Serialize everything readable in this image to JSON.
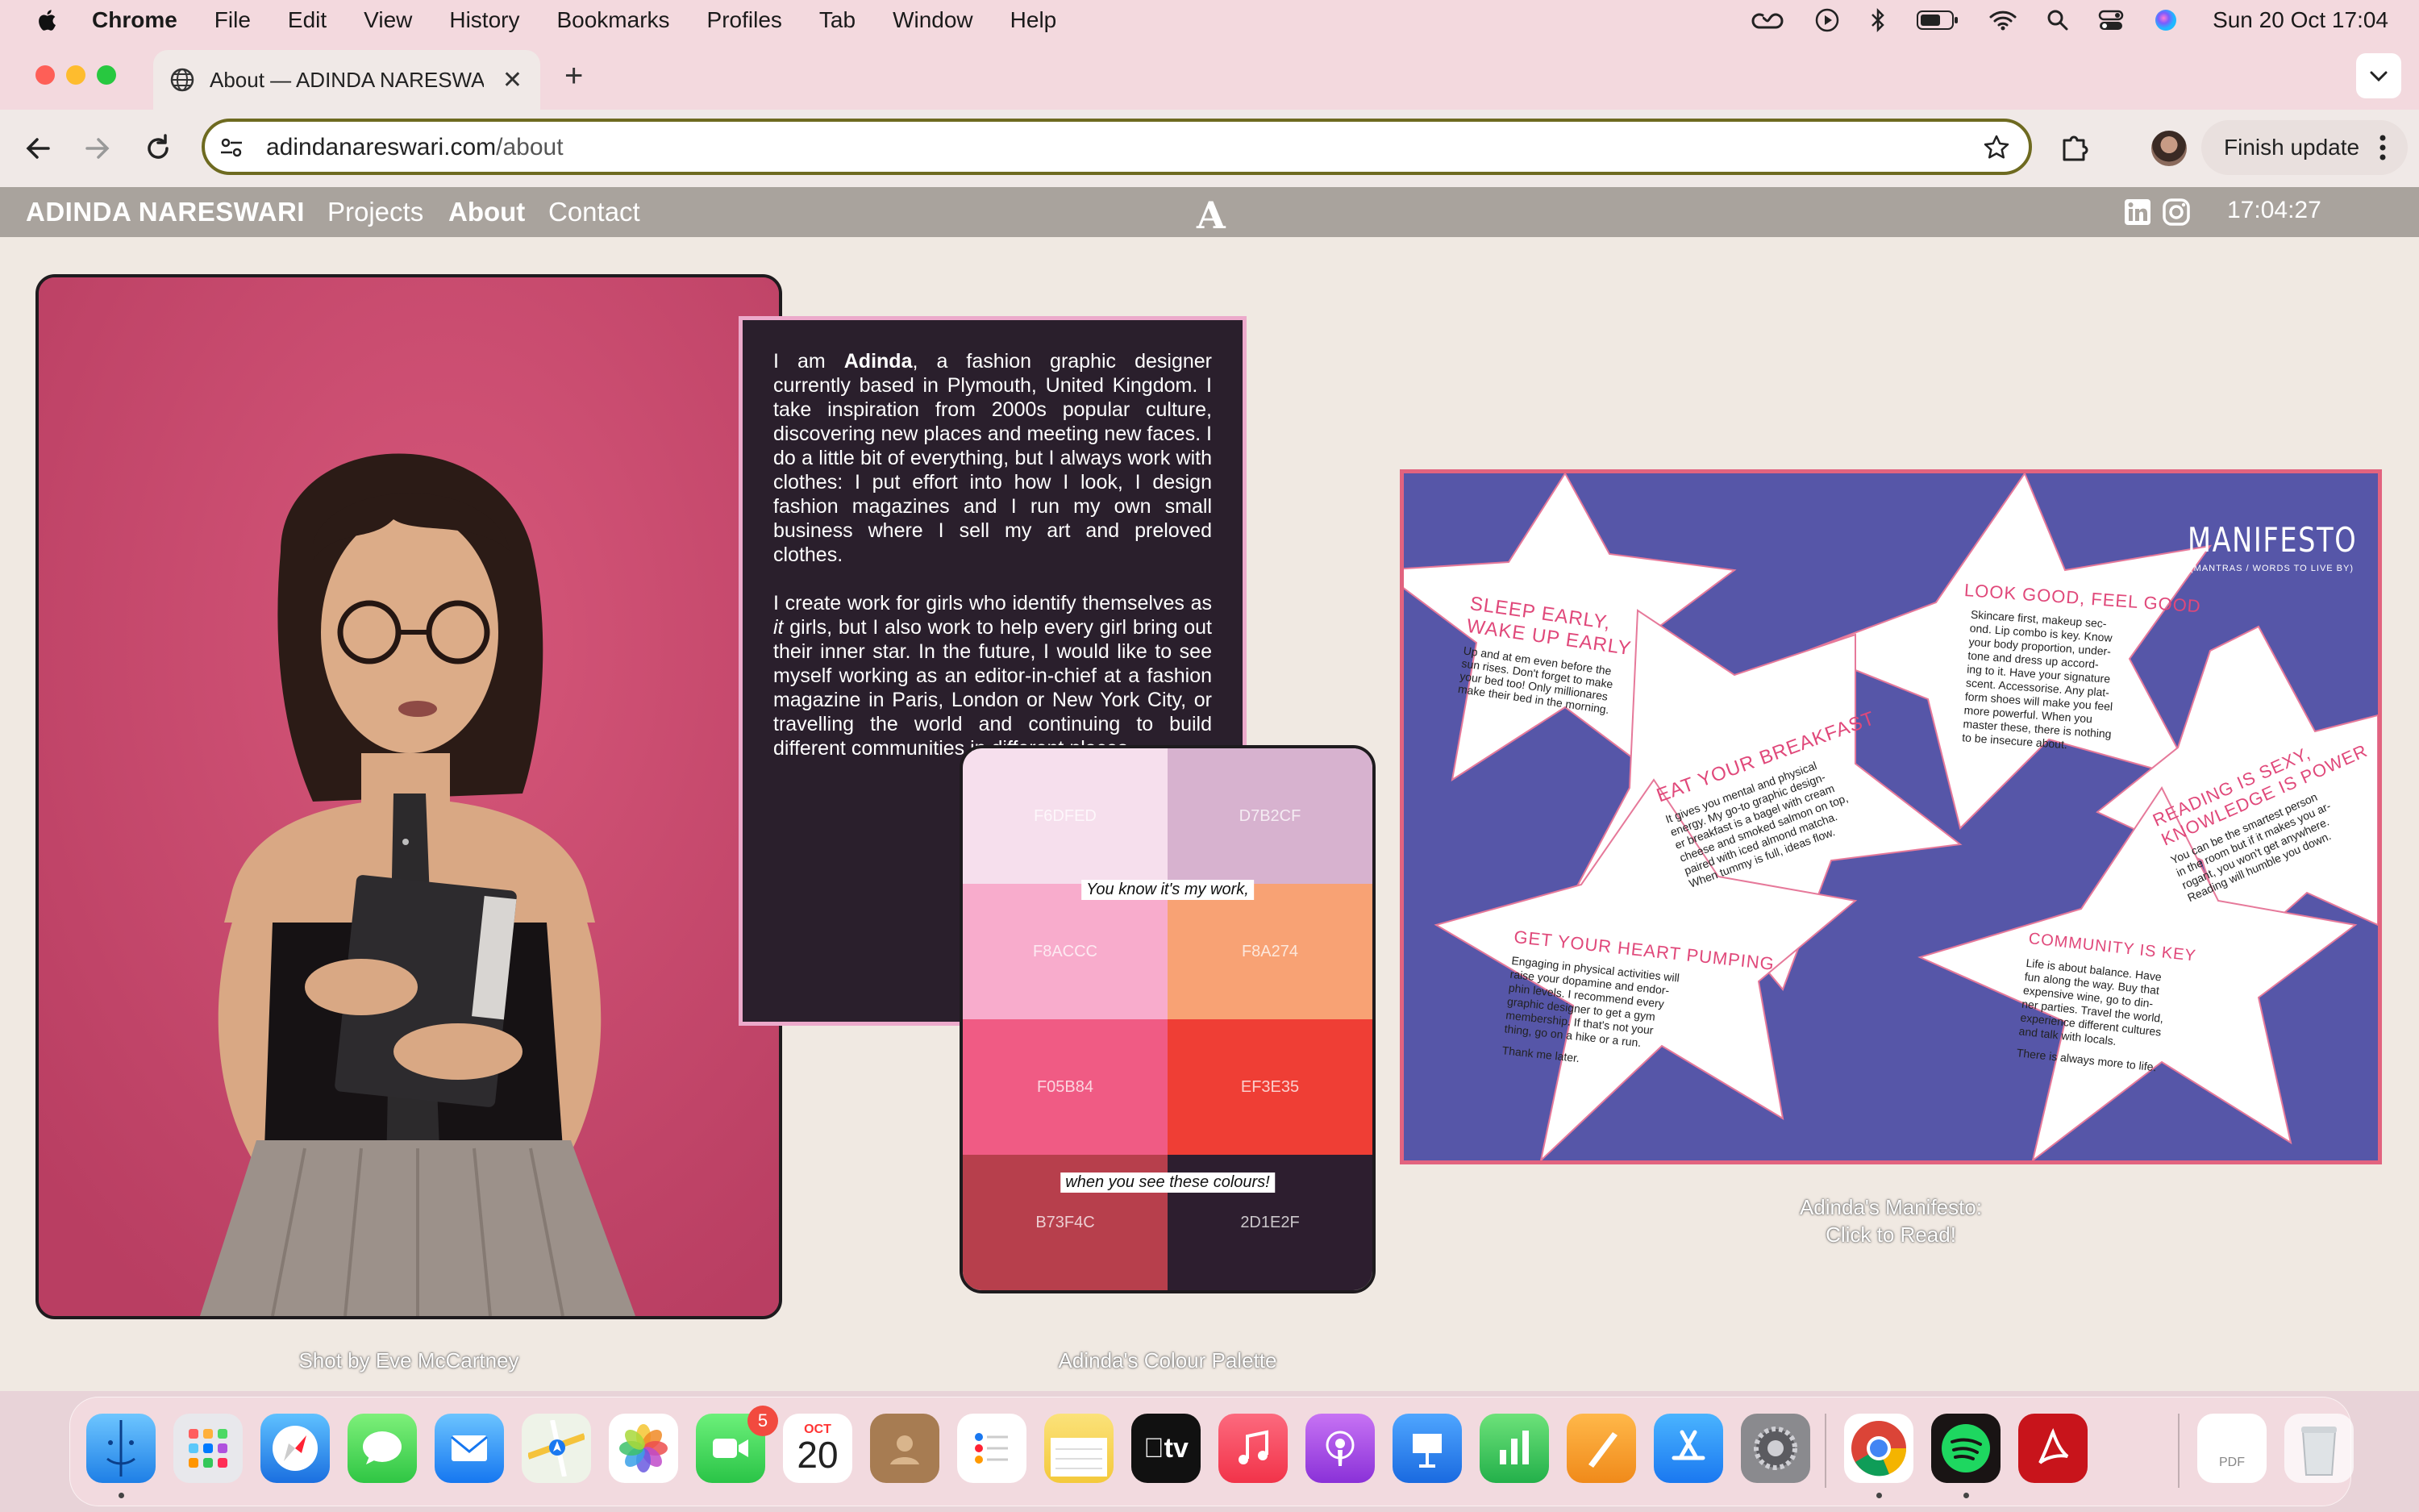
{
  "menubar": {
    "app_name": "Chrome",
    "items": [
      "File",
      "Edit",
      "View",
      "History",
      "Bookmarks",
      "Profiles",
      "Tab",
      "Window",
      "Help"
    ],
    "clock": "Sun 20 Oct  17:04",
    "status_icons": [
      "creative-cloud-icon",
      "play-icon",
      "bluetooth-icon",
      "battery-icon",
      "wifi-icon",
      "spotlight-search-icon",
      "control-center-icon",
      "siri-icon"
    ]
  },
  "browser": {
    "tab_title": "About — ADINDA NARESWARI",
    "url_domain": "adindanareswari.com",
    "url_path": "/about",
    "finish_update_label": "Finish update"
  },
  "site": {
    "brand": "ADINDA NARESWARI",
    "nav": {
      "projects": "Projects",
      "about": "About",
      "contact": "Contact"
    },
    "logo_letter": "A",
    "time": "17:04:27"
  },
  "about": {
    "photo_caption": "Shot by Eve McCartney",
    "bio_p1_pre": "I am ",
    "bio_name": "Adinda",
    "bio_p1_post": ", a fashion graphic designer currently based in Plymouth, United Kingdom. I take inspiration from 2000s popular culture, discovering new places and meeting new faces. I do a little bit of everything, but I always work with clothes: I put effort into how I look, I design fashion magazines and I run my own small business where I sell my art and preloved clothes.",
    "bio_p2_pre": "I create work for girls who identify themselves as ",
    "bio_p2_it": "it",
    "bio_p2_post": " girls, but I also work to help every girl bring out their inner star. In the future, I would like to see myself working as an editor-in-chief at a fashion magazine in Paris, London or New York City, or travelling the world and continuing to build different communities in different places."
  },
  "palette": {
    "swatches": [
      {
        "hex": "F6DFED",
        "color": "#F6DFED"
      },
      {
        "hex": "D7B2CF",
        "color": "#D7B2CF"
      },
      {
        "hex": "F8ACCC",
        "color": "#F8ACCC"
      },
      {
        "hex": "F8A274",
        "color": "#F8A274"
      },
      {
        "hex": "F05B84",
        "color": "#F05B84"
      },
      {
        "hex": "EF3E35",
        "color": "#EF3E35"
      },
      {
        "hex": "B73F4C",
        "color": "#B73F4C"
      },
      {
        "hex": "2D1E2F",
        "color": "#2D1E2F"
      }
    ],
    "quote_1": "You know it's my work,",
    "quote_2": "when you see these colours!",
    "caption": "Adinda's Colour Palette"
  },
  "manifesto": {
    "title": "MANIFESTO",
    "subtitle": "(MANTRAS / WORDS TO LIVE BY)",
    "items": [
      {
        "heading_1": "SLEEP EARLY,",
        "heading_2": "WAKE UP EARLY",
        "body": [
          "Up and at em even before the",
          "sun rises. Don't forget to make",
          "your bed too! Only millionares",
          "make their bed in the morning."
        ]
      },
      {
        "heading": "LOOK GOOD, FEEL GOOD",
        "body": [
          "Skincare first, makeup sec-",
          "ond. Lip combo is key. Know",
          "your body proportion, under-",
          "tone and dress up accord-",
          "ing to it. Have your signature",
          "scent. Accessorise. Any plat-",
          "form shoes will make you feel",
          "more powerful. When you",
          "master these, there is nothing",
          "to be insecure about."
        ]
      },
      {
        "heading": "EAT YOUR BREAKFAST",
        "body": [
          "It gives you mental and physical",
          "energy. My go-to graphic design-",
          "er breakfast is a bagel with cream",
          "cheese and smoked salmon on top,",
          "paired with iced almond matcha.",
          "When tummy is full, ideas flow."
        ]
      },
      {
        "heading_1": "READING IS SEXY,",
        "heading_2": "KNOWLEDGE IS POWER",
        "body": [
          "You can be the smartest person",
          "in the room but if it makes you ar-",
          "rogant, you won't get anywhere.",
          "Reading will humble you down."
        ]
      },
      {
        "heading": "GET YOUR HEART PUMPING",
        "body": [
          "Engaging in physical activities will",
          "raise your dopamine and endor-",
          "phin levels. I recommend every",
          "graphic designer to get a gym",
          "membership. If that's not your",
          "thing, go on a hike or a run.",
          "Thank me later."
        ]
      },
      {
        "heading": "COMMUNITY IS KEY",
        "body": [
          "Life is about balance. Have",
          "fun along the way. Buy that",
          "expensive wine, go to din-",
          "ner parties. Travel the world,",
          "experience different cultures",
          "and talk with locals.",
          "There is always more to life."
        ]
      }
    ],
    "caption_1": "Adinda's Manifesto:",
    "caption_2": "Click to Read!"
  },
  "dock": {
    "apps": [
      "Finder",
      "Launchpad",
      "Safari",
      "Messages",
      "Mail",
      "Maps",
      "Photos",
      "FaceTime",
      "Calendar",
      "Contacts",
      "Reminders",
      "Notes",
      "TV",
      "Music",
      "Podcasts",
      "Keynote",
      "Numbers",
      "Pages",
      "App Store",
      "System Settings",
      "Chrome",
      "Spotify",
      "Acrobat",
      "Documents",
      "Trash"
    ],
    "facetime_badge": "5",
    "calendar_month": "OCT",
    "calendar_day": "20",
    "tv_label": "tv",
    "pdf_label": "PDF"
  },
  "colors": {
    "menubar_bg": "#f3d9de",
    "site_nav_bg": "#a9a39d",
    "page_bg": "#f0e9e2",
    "photo_bg": "#c94a6c",
    "bio_bg": "#2a1f2c",
    "bio_border": "#ecaacb",
    "manifesto_bg": "#5656a8",
    "manifesto_border": "#e2637f",
    "manifesto_heading": "#e0487a",
    "omnibox_border": "#6e6a20"
  }
}
